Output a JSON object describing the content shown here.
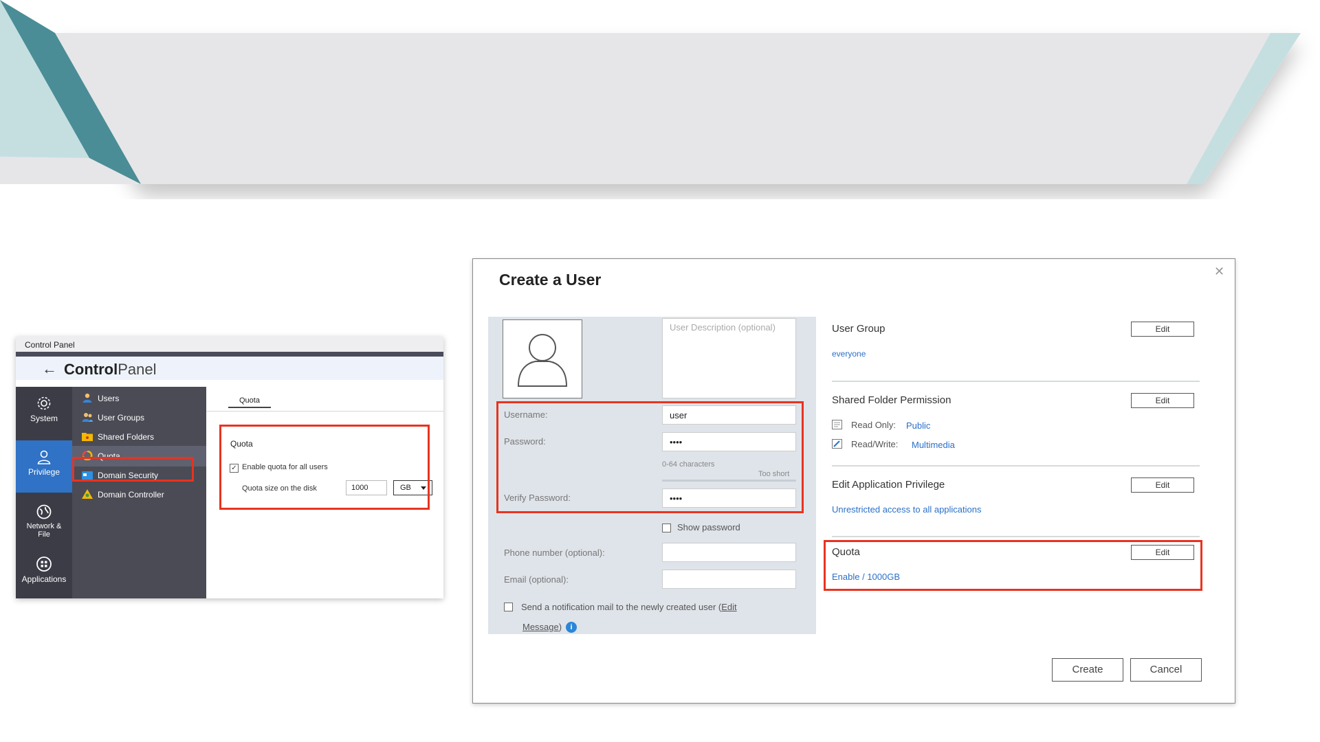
{
  "colors": {
    "accent_red": "#e8331f",
    "privilege_blue": "#2f72c6",
    "link_blue": "#2a70c8",
    "banner_teal": "#4a8d96"
  },
  "control_panel": {
    "window_title": "Control Panel",
    "back_icon": "arrow-left-icon",
    "app_title_bold": "Control",
    "app_title_light": "Panel",
    "rail": [
      {
        "label": "System",
        "icon": "gear-icon"
      },
      {
        "label": "Privilege",
        "icon": "user-icon"
      },
      {
        "label": "Network &\nFile",
        "icon": "globe-icon"
      },
      {
        "label": "Applications",
        "icon": "apps-grid-icon"
      }
    ],
    "menu": [
      {
        "label": "Users",
        "icon": "users-icon"
      },
      {
        "label": "User Groups",
        "icon": "user-groups-icon"
      },
      {
        "label": "Shared Folders",
        "icon": "shared-folder-icon"
      },
      {
        "label": "Quota",
        "icon": "quota-icon"
      },
      {
        "label": "Domain Security",
        "icon": "domain-security-icon"
      },
      {
        "label": "Domain Controller",
        "icon": "domain-controller-icon"
      }
    ],
    "tab": "Quota",
    "section_title": "Quota",
    "enable_label": "Enable quota for all users",
    "enable_checked": true,
    "size_label": "Quota size on the disk",
    "size_value": "1000",
    "unit": "GB"
  },
  "create_user": {
    "title": "Create a User",
    "close_icon": "close-icon",
    "description_placeholder": "User Description (optional)",
    "username_label": "Username:",
    "username_value": "user",
    "password_label": "Password:",
    "password_value": "••••",
    "password_hint": "0-64 characters",
    "password_strength": "Too short",
    "verify_label": "Verify Password:",
    "verify_value": "••••",
    "show_password": "Show password",
    "phone_label": "Phone number (optional):",
    "email_label": "Email (optional):",
    "notify_text": "Send a notification mail to the newly created user (",
    "notify_link_1": "Edit",
    "notify_link_2": "Message",
    "notify_close": ")",
    "user_group_title": "User Group",
    "user_group_value": "everyone",
    "shared_folder_title": "Shared Folder Permission",
    "read_only_label": "Read Only:",
    "read_only_value": "Public",
    "read_write_label": "Read/Write:",
    "read_write_value": "Multimedia",
    "app_privilege_title": "Edit Application Privilege",
    "app_privilege_value": "Unrestricted access to all applications",
    "quota_title": "Quota",
    "quota_value": "Enable / 1000GB",
    "edit_label": "Edit",
    "create_label": "Create",
    "cancel_label": "Cancel"
  }
}
